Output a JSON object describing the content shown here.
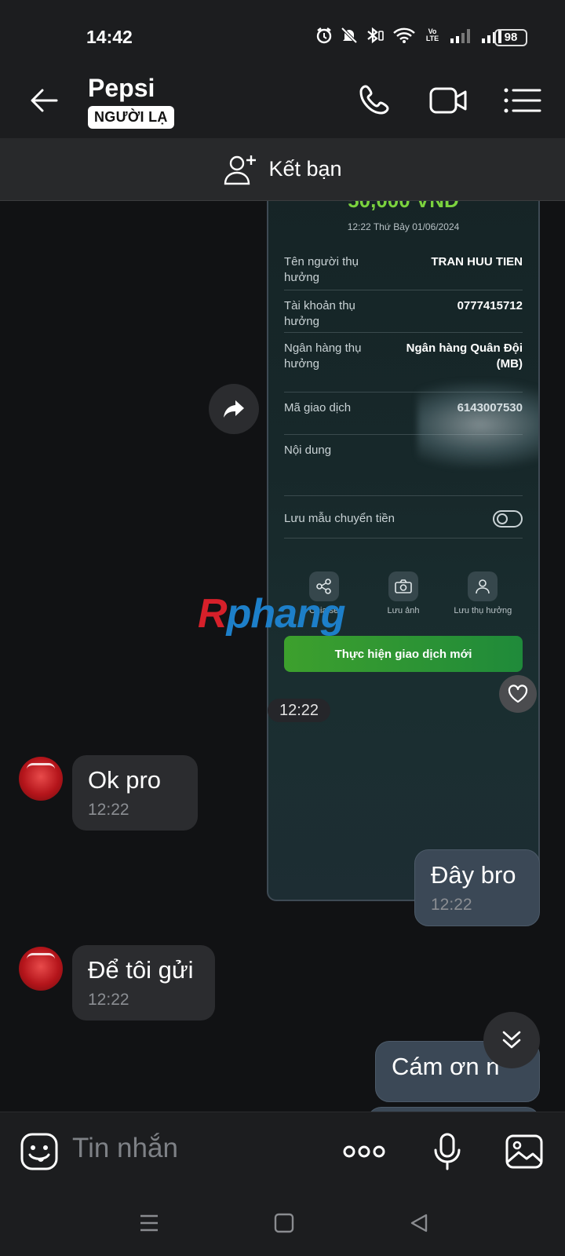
{
  "status_bar": {
    "time": "14:42",
    "battery": "98",
    "network": "Vo LTE"
  },
  "header": {
    "title": "Pepsi",
    "badge": "NGƯỜI LẠ"
  },
  "friend_bar": {
    "label": "Kết bạn"
  },
  "receipt": {
    "amount": "50,000 VND",
    "datetime": "12:22 Thứ Bảy 01/06/2024",
    "rows": [
      {
        "label": "Tên người thụ hưởng",
        "value": "TRAN HUU TIEN"
      },
      {
        "label": "Tài khoản thụ hưởng",
        "value": "0777415712"
      },
      {
        "label": "Ngân hàng thụ hưởng",
        "value": "Ngân hàng Quân Đội (MB)"
      },
      {
        "label": "Mã giao dịch",
        "value": "6143007530"
      },
      {
        "label": "Nội dung",
        "value": ""
      },
      {
        "label": "Lưu mẫu chuyển tiền",
        "value": ""
      }
    ],
    "actions": [
      "Chia sẻ",
      "Lưu ảnh",
      "Lưu thụ hưởng"
    ],
    "button": "Thực hiện giao dịch mới"
  },
  "watermark": {
    "part1": "R",
    "part2": "phang"
  },
  "image_time": "12:22",
  "messages": [
    {
      "dir": "in",
      "text": "Ok pro",
      "time": "12:22"
    },
    {
      "dir": "out",
      "text": "Đây bro",
      "time": "12:22"
    },
    {
      "dir": "in",
      "text": "Để tôi gửi",
      "time": "12:22"
    },
    {
      "dir": "out",
      "text": "Cám ơn n",
      "time": ""
    }
  ],
  "input": {
    "placeholder": "Tin nhắn"
  },
  "colors": {
    "accent_green": "#7bd23e",
    "bubble_out": "#3b4856",
    "bubble_in": "#2b2c2f"
  }
}
